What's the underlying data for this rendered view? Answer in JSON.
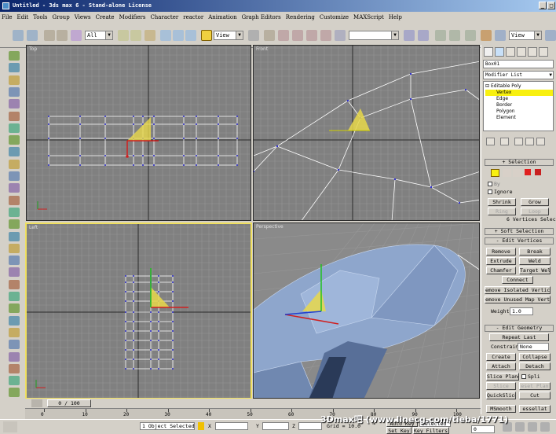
{
  "window": {
    "title": "Untitled - 3ds max 6 - Stand-alone License"
  },
  "menu": [
    "File",
    "Edit",
    "Tools",
    "Group",
    "Views",
    "Create",
    "Modifiers",
    "Character",
    "reactor",
    "Animation",
    "Graph Editors",
    "Rendering",
    "Customize",
    "MAXScript",
    "Help"
  ],
  "toolbar": {
    "filter_value": "All",
    "coord_value": "View",
    "coord2_value": "View"
  },
  "viewports": {
    "top": "Top",
    "front": "Front",
    "left": "Left",
    "perspective": "Perspective"
  },
  "panel": {
    "object_name": "Box01",
    "modifier_list": "Modifier List",
    "stack": [
      "Editable Poly",
      "Vertex",
      "Edge",
      "Border",
      "Polygon",
      "Element"
    ],
    "selection": {
      "header": "Selection",
      "by": "By",
      "ignore": "Ignore",
      "shrink": "Shrink",
      "grow": "Grow",
      "ring": "Ring",
      "loop": "Loop",
      "status": "6 Vertices Selected"
    },
    "soft_selection": "Soft Selection",
    "edit_vertices": {
      "header": "Edit Vertices",
      "remove": "Remove",
      "break": "Break",
      "extrude": "Extrude",
      "weld": "Weld",
      "chamfer": "Chamfer",
      "target_weld": "Target Weld",
      "connect": "Connect",
      "remove_isolated": "emove Isolated Vertice",
      "remove_unused": "emove Unused Map Vert",
      "weight_label": "Weight:",
      "weight_value": "1.0"
    },
    "edit_geometry": {
      "header": "Edit Geometry",
      "repeat_last": "Repeat Last",
      "constraints_label": "Constraints:",
      "constraints_value": "None",
      "create": "Create",
      "collapse": "Collapse",
      "attach": "Attach",
      "detach": "Detach",
      "slice_plane": "Slice Plane",
      "split": "Spli",
      "slice": "Slice",
      "reset_plane": "eset Plan",
      "quickslice": "QuickSlice",
      "cut": "Cut",
      "msmooth": "MSmooth",
      "tessellate": "essellat"
    }
  },
  "timeline": {
    "frame": "0 / 100",
    "ticks": [
      "0",
      "10",
      "20",
      "30",
      "40",
      "50",
      "60",
      "70",
      "80",
      "90",
      "100"
    ]
  },
  "status": {
    "selected": "1 Object Selected",
    "x_label": "X",
    "y_label": "Y",
    "z_label": "Z",
    "grid": "Grid = 10.0",
    "autokey": "Auto Key",
    "selected_dd": "Selected",
    "setkey": "Set Key",
    "keyfilters": "Key Filters...",
    "frame_field": "0",
    "watermark": "3Dmax吧  (www.linecg.com/tieba/1771)"
  },
  "colors": {
    "viewport_bg": "#808080",
    "grid_line": "#939393",
    "wire": "#ffffff",
    "selected_fill": "#e8d84a",
    "accent_yellow": "#f0e060",
    "vertex": "#3030d0"
  }
}
